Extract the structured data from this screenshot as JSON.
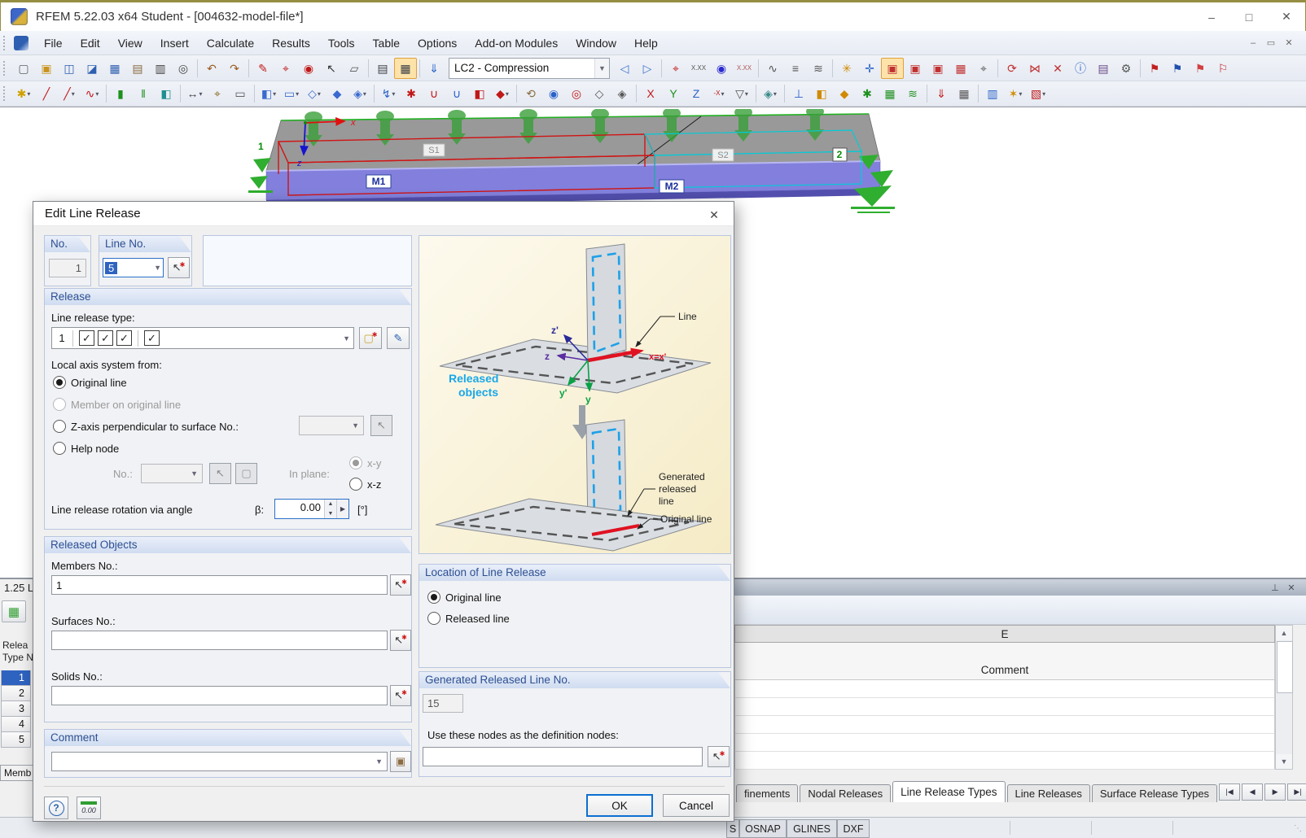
{
  "window": {
    "title": "RFEM 5.22.03 x64 Student - [004632-model-file*]",
    "buttons": {
      "minimize": "–",
      "maximize": "□",
      "close": "✕"
    }
  },
  "menu": {
    "items": [
      "File",
      "Edit",
      "View",
      "Insert",
      "Calculate",
      "Results",
      "Tools",
      "Table",
      "Options",
      "Add-on Modules",
      "Window",
      "Help"
    ],
    "mdi": {
      "minimize": "–",
      "restore": "▭",
      "close": "✕"
    }
  },
  "toolbar1": {
    "load_case": "LC2 - Compression",
    "left": [
      {
        "name": "new-model",
        "glyph": "▢",
        "c": "#5a5f66"
      },
      {
        "name": "open-model",
        "glyph": "▣",
        "c": "#c9931f"
      },
      {
        "name": "open-project",
        "glyph": "◫",
        "c": "#2f5fb0"
      },
      {
        "name": "save-model-as",
        "glyph": "◪",
        "c": "#2f5fb0"
      },
      {
        "name": "save",
        "glyph": "▦",
        "c": "#2f5fb0"
      },
      {
        "name": "clipboard",
        "glyph": "▤",
        "c": "#8a6b42"
      },
      {
        "name": "print-graphic",
        "glyph": "▥",
        "c": "#444"
      },
      {
        "name": "print-preview",
        "glyph": "◎",
        "c": "#444"
      },
      {
        "sep": true
      },
      {
        "name": "undo",
        "glyph": "↶",
        "c": "#9a5a20"
      },
      {
        "name": "redo",
        "glyph": "↷",
        "c": "#9a5a20"
      },
      {
        "sep": true
      },
      {
        "name": "edit-selected",
        "glyph": "✎",
        "c": "#c01818"
      },
      {
        "name": "find-center",
        "glyph": "⌖",
        "c": "#c01818"
      },
      {
        "name": "zoom-center",
        "glyph": "◉",
        "c": "#c01818"
      },
      {
        "name": "select-cursor",
        "glyph": "↖",
        "c": "#333"
      },
      {
        "name": "copy-graphic",
        "glyph": "▱",
        "c": "#555"
      },
      {
        "sep": true
      },
      {
        "name": "tables-toggle",
        "glyph": "▤",
        "c": "#3a3f46"
      },
      {
        "name": "table-layout",
        "glyph": "▦",
        "c": "#3a3f46",
        "hl": true
      },
      {
        "sep": true
      },
      {
        "name": "regenerate-loads",
        "glyph": "⇓",
        "c": "#2a62c9"
      }
    ],
    "right": [
      {
        "name": "previous-load-case",
        "glyph": "◁",
        "c": "#3a72c9"
      },
      {
        "name": "next-load-case",
        "glyph": "▷",
        "c": "#3a72c9"
      },
      {
        "sep": true
      },
      {
        "name": "zoom-node",
        "glyph": "⌖",
        "c": "#c01818"
      },
      {
        "name": "extreme-values",
        "glyph": "X.XX",
        "c": "#555",
        "small": true
      },
      {
        "name": "result-point",
        "glyph": "◉",
        "c": "#2a2ad0"
      },
      {
        "name": "extreme-values-2",
        "glyph": "X.XX",
        "c": "#b05a5a",
        "small": true
      },
      {
        "sep": true
      },
      {
        "name": "wireframe-display",
        "glyph": "∿",
        "c": "#555"
      },
      {
        "name": "member-numbering",
        "glyph": "≡",
        "c": "#555"
      },
      {
        "name": "node-numbering",
        "glyph": "≋",
        "c": "#555"
      },
      {
        "sep": true
      },
      {
        "name": "snap",
        "glyph": "✳",
        "c": "#d08a00"
      },
      {
        "name": "grid",
        "glyph": "✛",
        "c": "#2a62c9"
      },
      {
        "name": "workplane-xy",
        "glyph": "▣",
        "c": "#c03030",
        "hl": true
      },
      {
        "name": "workplane-xz",
        "glyph": "▣",
        "c": "#c03030"
      },
      {
        "name": "workplane-yz",
        "glyph": "▣",
        "c": "#c03030"
      },
      {
        "name": "grid-settings",
        "glyph": "▦",
        "c": "#c03030"
      },
      {
        "name": "workplane-select",
        "glyph": "⌖",
        "c": "#555"
      },
      {
        "sep": true
      },
      {
        "name": "rotate-view",
        "glyph": "⟳",
        "c": "#c03030"
      },
      {
        "name": "mirror",
        "glyph": "⋈",
        "c": "#c03030"
      },
      {
        "name": "disconnect",
        "glyph": "✕",
        "c": "#c03030"
      },
      {
        "name": "object-info",
        "glyph": "ⓘ",
        "c": "#2a62c9"
      },
      {
        "name": "quick-calc",
        "glyph": "▤",
        "c": "#6a4a8a"
      },
      {
        "name": "settings",
        "glyph": "⚙",
        "c": "#555"
      },
      {
        "sep": true
      },
      {
        "name": "move-members",
        "glyph": "⚑",
        "c": "#c02020"
      },
      {
        "name": "copy-members",
        "glyph": "⚑",
        "c": "#1f4fae"
      },
      {
        "name": "result-flag",
        "glyph": "⚑",
        "c": "#d04040"
      },
      {
        "name": "result-flag-outline",
        "glyph": "⚐",
        "c": "#c02020"
      }
    ]
  },
  "toolbar2": {
    "icons": [
      {
        "name": "insert-node",
        "glyph": "✱",
        "c": "#d0a000",
        "dd": true
      },
      {
        "name": "insert-line",
        "glyph": "╱",
        "c": "#c01818"
      },
      {
        "name": "insert-line-type",
        "glyph": "╱",
        "c": "#c01818",
        "dd": true
      },
      {
        "name": "insert-arc",
        "glyph": "∿",
        "c": "#c01818",
        "dd": true
      },
      {
        "sep": true
      },
      {
        "name": "insert-member",
        "glyph": "▮",
        "c": "#1f8f1f"
      },
      {
        "name": "insert-member-set",
        "glyph": "‖",
        "c": "#1f8f1f"
      },
      {
        "name": "insert-surface",
        "glyph": "◧",
        "c": "#1f8f8f"
      },
      {
        "sep": true
      },
      {
        "name": "dimension",
        "glyph": "↔",
        "c": "#444",
        "dd": true
      },
      {
        "name": "dimension-values",
        "glyph": "⌖",
        "c": "#8a6b20"
      },
      {
        "name": "frame-select",
        "glyph": "▭",
        "c": "#555"
      },
      {
        "sep": true
      },
      {
        "name": "new-surface",
        "glyph": "◧",
        "c": "#3a6ad0",
        "dd": true
      },
      {
        "name": "surface-opening",
        "glyph": "▭",
        "c": "#3a6ad0",
        "dd": true
      },
      {
        "name": "nurbs-surface",
        "glyph": "◇",
        "c": "#3a6ad0",
        "dd": true
      },
      {
        "name": "new-solid",
        "glyph": "◆",
        "c": "#3a6ad0"
      },
      {
        "name": "solid-from-surfaces",
        "glyph": "◈",
        "c": "#3a6ad0",
        "dd": true
      },
      {
        "sep": true
      },
      {
        "name": "connect-lines",
        "glyph": "↯",
        "c": "#2a62c9",
        "dd": true
      },
      {
        "name": "nodal-release",
        "glyph": "✱",
        "c": "#c01818"
      },
      {
        "name": "line-release-insert",
        "glyph": "∪",
        "c": "#c01818"
      },
      {
        "name": "line-release-edit",
        "glyph": "∪",
        "c": "#2a62c9"
      },
      {
        "name": "surface-release",
        "glyph": "◧",
        "c": "#c01818"
      },
      {
        "name": "solid-release",
        "glyph": "◆",
        "c": "#c01818",
        "dd": true
      },
      {
        "sep": true
      },
      {
        "name": "pan-view",
        "glyph": "⟲",
        "c": "#8a6b42"
      },
      {
        "name": "zoom-in",
        "glyph": "◉",
        "c": "#2a62c9"
      },
      {
        "name": "zoom-out",
        "glyph": "◎",
        "c": "#c01818"
      },
      {
        "name": "isometric-view",
        "glyph": "◇",
        "c": "#555"
      },
      {
        "name": "perspective-view",
        "glyph": "◈",
        "c": "#555"
      },
      {
        "sep": true
      },
      {
        "name": "view-in-x",
        "glyph": "X",
        "c": "#c01818"
      },
      {
        "name": "view-in-y",
        "glyph": "Y",
        "c": "#1f8f1f"
      },
      {
        "name": "view-in-z",
        "glyph": "Z",
        "c": "#2a62c9"
      },
      {
        "name": "view-in-minus-x",
        "glyph": "-X",
        "c": "#c01818",
        "dd": true,
        "small": true
      },
      {
        "name": "user-defined-view",
        "glyph": "▽",
        "c": "#555",
        "dd": true
      },
      {
        "sep": true
      },
      {
        "name": "visibility-modes",
        "glyph": "◈",
        "c": "#3a8a8a",
        "dd": true
      },
      {
        "sep": true
      },
      {
        "name": "show-supports",
        "glyph": "⊥",
        "c": "#2a62c9"
      },
      {
        "name": "surface-colors",
        "glyph": "◧",
        "c": "#d08a00"
      },
      {
        "name": "solid-render",
        "glyph": "◆",
        "c": "#d08a00"
      },
      {
        "name": "show-nodes",
        "glyph": "✱",
        "c": "#1f8f1f"
      },
      {
        "name": "fe-mesh",
        "glyph": "▦",
        "c": "#1f8f1f"
      },
      {
        "name": "mesh-points",
        "glyph": "≋",
        "c": "#1f8f1f"
      },
      {
        "sep": true
      },
      {
        "name": "show-loads",
        "glyph": "⇓",
        "c": "#c01818"
      },
      {
        "name": "show-tables",
        "glyph": "▦",
        "c": "#555"
      },
      {
        "sep": true
      },
      {
        "name": "panel-toggle",
        "glyph": "▥",
        "c": "#2a62c9"
      },
      {
        "name": "display-properties",
        "glyph": "✶",
        "c": "#d08a00",
        "dd": true
      },
      {
        "name": "color-scale",
        "glyph": "▧",
        "c": "#c01818",
        "dd": true
      }
    ]
  },
  "viewport": {
    "m1": "M1",
    "m2": "M2",
    "s1": "S1",
    "s2": "S2",
    "n1": "1",
    "n2": "2",
    "axis_x": "x",
    "axis_z": "z"
  },
  "dialog": {
    "title": "Edit Line Release",
    "close": "✕",
    "no_label": "No.",
    "no_value": "1",
    "line_no_label": "Line No.",
    "line_no_value": "5",
    "release": {
      "header": "Release",
      "type_label": "Line release type:",
      "type_no": "1",
      "check": "✓",
      "local_axis_label": "Local axis system from:",
      "opt_original": "Original line",
      "opt_member": "Member on original line",
      "opt_zaxis": "Z-axis perpendicular to surface No.:",
      "opt_help": "Help node",
      "no_small_label": "No.:",
      "in_plane_label": "In plane:",
      "opt_xy": "x-y",
      "opt_xz": "x-z",
      "rot_label": "Line release rotation via angle",
      "beta_label": "β:",
      "rot_value": "0.00",
      "deg_label": "[°]"
    },
    "released": {
      "header": "Released Objects",
      "members_label": "Members No.:",
      "members_value": "1",
      "surfaces_label": "Surfaces No.:",
      "solids_label": "Solids No.:"
    },
    "comment_header": "Comment",
    "location": {
      "header": "Location of Line Release",
      "opt_original": "Original line",
      "opt_released": "Released line"
    },
    "generated": {
      "header": "Generated Released Line No.",
      "value": "15",
      "use_nodes_label": "Use these nodes as the definition nodes:"
    },
    "ok": "OK",
    "cancel": "Cancel",
    "help_glyph": "?",
    "units_glyph": "0.00",
    "diagram": {
      "line": "Line",
      "released_1": "Released",
      "released_2": "objects",
      "gen_1": "Generated",
      "gen_2": "released",
      "gen_3": "line",
      "original": "Original line",
      "z_prime": "z'",
      "z": "z",
      "y_prime": "y'",
      "y": "y",
      "x_eq": "x=x'"
    }
  },
  "bottom": {
    "left_title": "1.25 L",
    "col_header_a": "Relea",
    "col_header_b": "Type N",
    "rows": [
      "1",
      "2",
      "3",
      "4",
      "5"
    ],
    "selected_row": "1",
    "memb_tab": "Memb",
    "col_letter": "E",
    "col_title": "Comment",
    "tabs": [
      {
        "label": "finements",
        "active": false
      },
      {
        "label": "Nodal Releases",
        "active": false
      },
      {
        "label": "Line Release Types",
        "active": true
      },
      {
        "label": "Line Releases",
        "active": false
      },
      {
        "label": "Surface Release Types",
        "active": false
      }
    ],
    "nav": [
      "|◀",
      "◀",
      "▶",
      "▶|"
    ],
    "scroll_up": "▲",
    "scroll_down": "▼",
    "pin_glyph": "⊤",
    "close_glyph": "✕"
  },
  "statusbar": {
    "buttons": [
      "S",
      "OSNAP",
      "GLINES",
      "DXF"
    ],
    "grip": "⋱"
  },
  "colors": {
    "accent_blue": "#0b6fd0",
    "selection_blue": "#2f63c0",
    "group_header_text": "#2d4f92",
    "member_purple": "#8280dc",
    "support_green": "#2fae2f",
    "selection_red": "#d01414",
    "selection_cyan": "#00ccd8",
    "released_cyan": "#19a7e8",
    "orange_line": "#f59b1f"
  }
}
